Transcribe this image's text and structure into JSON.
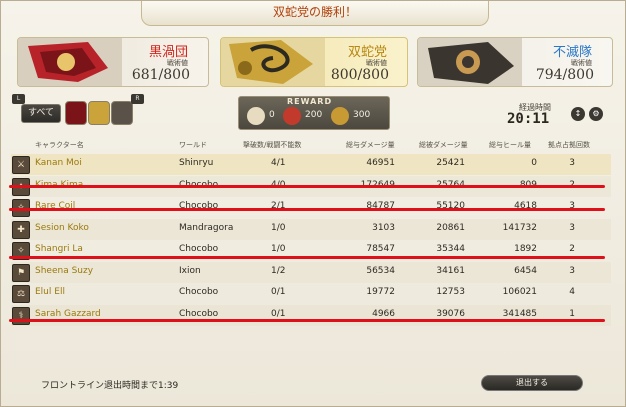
{
  "title": "双蛇党の勝利！",
  "teams": [
    {
      "name": "黒渦団",
      "sub_label": "戦術値",
      "score": "681/800",
      "color": "#d1241b"
    },
    {
      "name": "双蛇党",
      "sub_label": "戦術値",
      "score": "800/800",
      "color": "#b8870f"
    },
    {
      "name": "不滅隊",
      "sub_label": "戦術値",
      "score": "794/800",
      "color": "#2a78c8"
    }
  ],
  "filter": {
    "all_label": "すべて",
    "key_left": "L",
    "key_right": "R"
  },
  "reward": {
    "label": "REWARD",
    "values": [
      "0",
      "200",
      "300"
    ]
  },
  "elapsed": {
    "label": "経過時間",
    "time": "20:11"
  },
  "columns": [
    "キャラクター名",
    "ワールド",
    "撃破数/戦闘不能数",
    "総与ダメージ量",
    "総被ダメージ量",
    "総与ヒール量",
    "拠点占拠回数"
  ],
  "rows": [
    {
      "name": "Kanan Moi",
      "world": "Shinryu",
      "kd": "4/1",
      "dmg": "46951",
      "taken": "25421",
      "heal": "0",
      "cap": "3",
      "job": "⚔"
    },
    {
      "name": "Kima Kima",
      "world": "Chocobo",
      "kd": "4/0",
      "dmg": "172649",
      "taken": "25764",
      "heal": "809",
      "cap": "2",
      "job": "✦"
    },
    {
      "name": "Rare Coil",
      "world": "Chocobo",
      "kd": "2/1",
      "dmg": "84787",
      "taken": "55120",
      "heal": "4618",
      "cap": "3",
      "job": "✧"
    },
    {
      "name": "Sesion Koko",
      "world": "Mandragora",
      "kd": "1/0",
      "dmg": "3103",
      "taken": "20861",
      "heal": "141732",
      "cap": "3",
      "job": "✚"
    },
    {
      "name": "Shangri La",
      "world": "Chocobo",
      "kd": "1/0",
      "dmg": "78547",
      "taken": "35344",
      "heal": "1892",
      "cap": "2",
      "job": "✧"
    },
    {
      "name": "Sheena Suzy",
      "world": "Ixion",
      "kd": "1/2",
      "dmg": "56534",
      "taken": "34161",
      "heal": "6454",
      "cap": "3",
      "job": "⚑"
    },
    {
      "name": "Elul Ell",
      "world": "Chocobo",
      "kd": "0/1",
      "dmg": "19772",
      "taken": "12753",
      "heal": "106021",
      "cap": "4",
      "job": "⚖"
    },
    {
      "name": "Sarah Gazzard",
      "world": "Chocobo",
      "kd": "0/1",
      "dmg": "4966",
      "taken": "39076",
      "heal": "341485",
      "cap": "1",
      "job": "⚕"
    }
  ],
  "footer": {
    "timer_text": "フロントライン退出時間まで1:39",
    "leave_label": "退出する"
  }
}
